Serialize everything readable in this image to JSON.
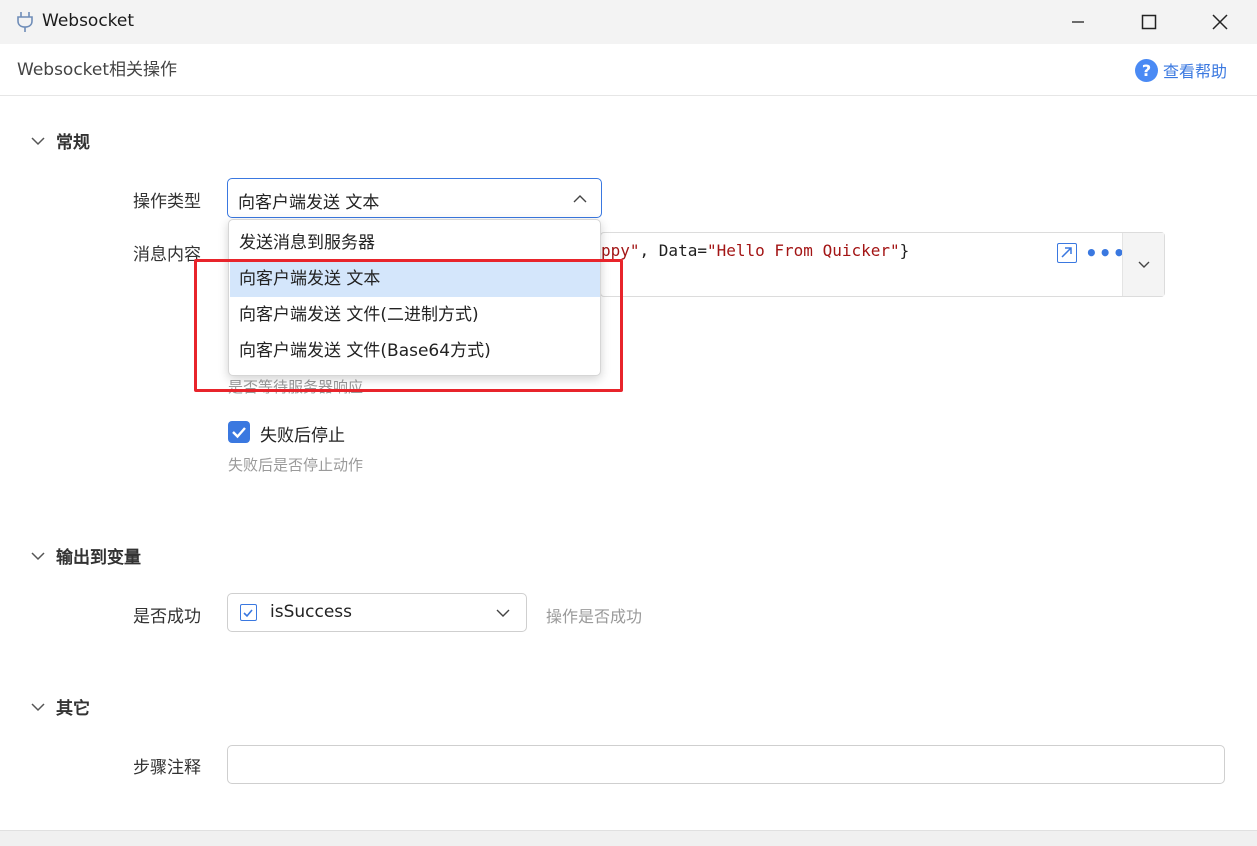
{
  "window": {
    "title": "Websocket",
    "subtitle": "Websocket相关操作",
    "help_label": "查看帮助"
  },
  "sections": {
    "general": "常规",
    "output": "输出到变量",
    "other": "其它"
  },
  "fields": {
    "op_type_label": "操作类型",
    "op_type_value": "向客户端发送 文本",
    "message_label": "消息内容",
    "message_code": {
      "part1": "ppy\"",
      "part2": ", Data=",
      "part3": "\"Hello From Quicker\"",
      "part4": "}"
    },
    "wait_hint": "是否等待服务器响应",
    "stop_on_fail_label": "失败后停止",
    "stop_on_fail_checked": true,
    "stop_on_fail_hint": "失败后是否停止动作",
    "success_label": "是否成功",
    "success_var": "isSuccess",
    "success_hint": "操作是否成功",
    "note_label": "步骤注释",
    "note_value": ""
  },
  "dropdown": {
    "options": [
      "发送消息到服务器",
      "向客户端发送 文本",
      "向客户端发送 文件(二进制方式)",
      "向客户端发送 文件(Base64方式)"
    ],
    "selected": "向客户端发送 文本"
  },
  "colors": {
    "accent": "#3a78e0",
    "highlight": "#e8242b",
    "selected_bg": "#d4e6fb"
  }
}
